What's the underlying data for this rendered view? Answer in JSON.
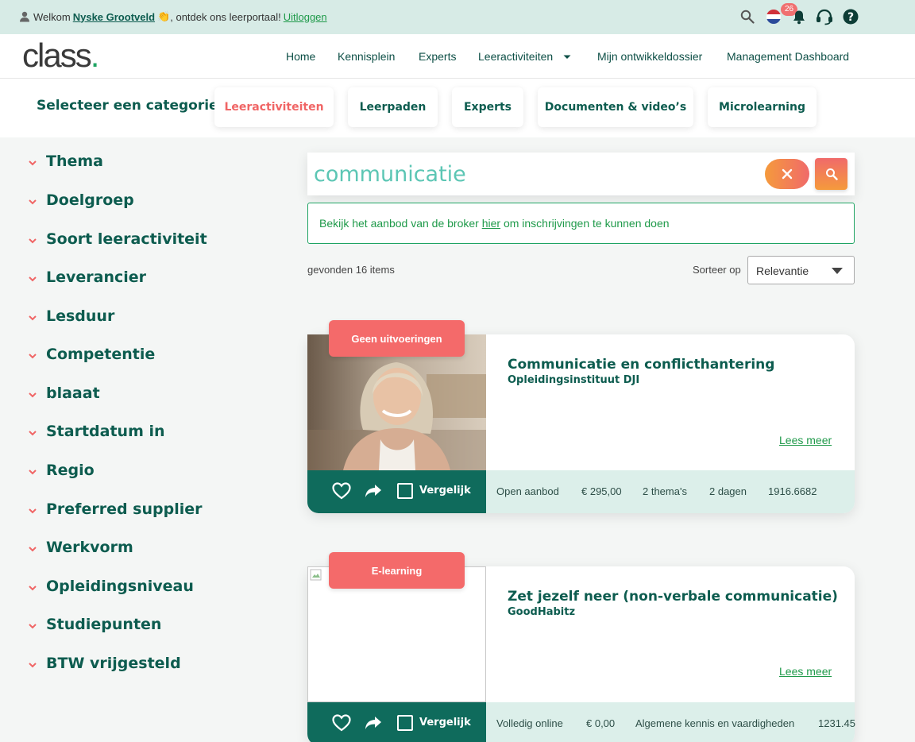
{
  "topbar": {
    "welcome_prefix": "Welkom",
    "user_name": "Nyske Grootveld",
    "welcome_suffix": ", ontdek ons leerportaal!",
    "logout": "Uitloggen",
    "notifications_count": "26"
  },
  "nav": {
    "logo_text": "class",
    "logo_dot": ".",
    "links": [
      "Home",
      "Kennisplein",
      "Experts",
      "Leeractiviteiten",
      "Mijn ontwikkeldossier",
      "Management Dashboard"
    ]
  },
  "categories": {
    "title": "Selecteer een categorie",
    "items": [
      "Leeractiviteiten",
      "Leerpaden",
      "Experts",
      "Documenten & video’s",
      "Microlearning"
    ],
    "active": "Leeractiviteiten"
  },
  "filters": [
    "Thema",
    "Doelgroep",
    "Soort leeractiviteit",
    "Leverancier",
    "Lesduur",
    "Competentie",
    "blaaat",
    "Startdatum in",
    "Regio",
    "Preferred supplier",
    "Werkvorm",
    "Opleidingsniveau",
    "Studiepunten",
    "BTW vrijgesteld"
  ],
  "search": {
    "value": "communicatie"
  },
  "notice": {
    "before": "Bekijk het aanbod van de broker ",
    "link": "hier",
    "after": " om inschrijvingen te kunnen doen"
  },
  "results": {
    "count_text": "gevonden 16 items",
    "sort_label": "Sorteer op",
    "sort_value": "Relevantie"
  },
  "cards": [
    {
      "tag": "Geen uitvoeringen",
      "title": "Communicatie en conflicthantering",
      "provider": "Opleidingsinstituut DJI",
      "more": "Lees meer",
      "compare": "Vergelijk",
      "meta": [
        "Open aanbod",
        "€ 295,00",
        "2 thema's",
        "2 dagen",
        "1916.6682"
      ]
    },
    {
      "tag": "E-learning",
      "title": "Zet jezelf neer (non-verbale communicatie)",
      "provider": "GoodHabitz",
      "more": "Lees meer",
      "compare": "Vergelijk",
      "meta": [
        "Volledig online",
        "€ 0,00",
        "Algemene kennis en vaardigheden",
        "1231.45"
      ]
    }
  ],
  "colors": {
    "primary": "#0d5c4f",
    "accent": "#f46a6a",
    "topbar_bg": "#d7ebe6",
    "meta_bg": "#dcefea"
  }
}
